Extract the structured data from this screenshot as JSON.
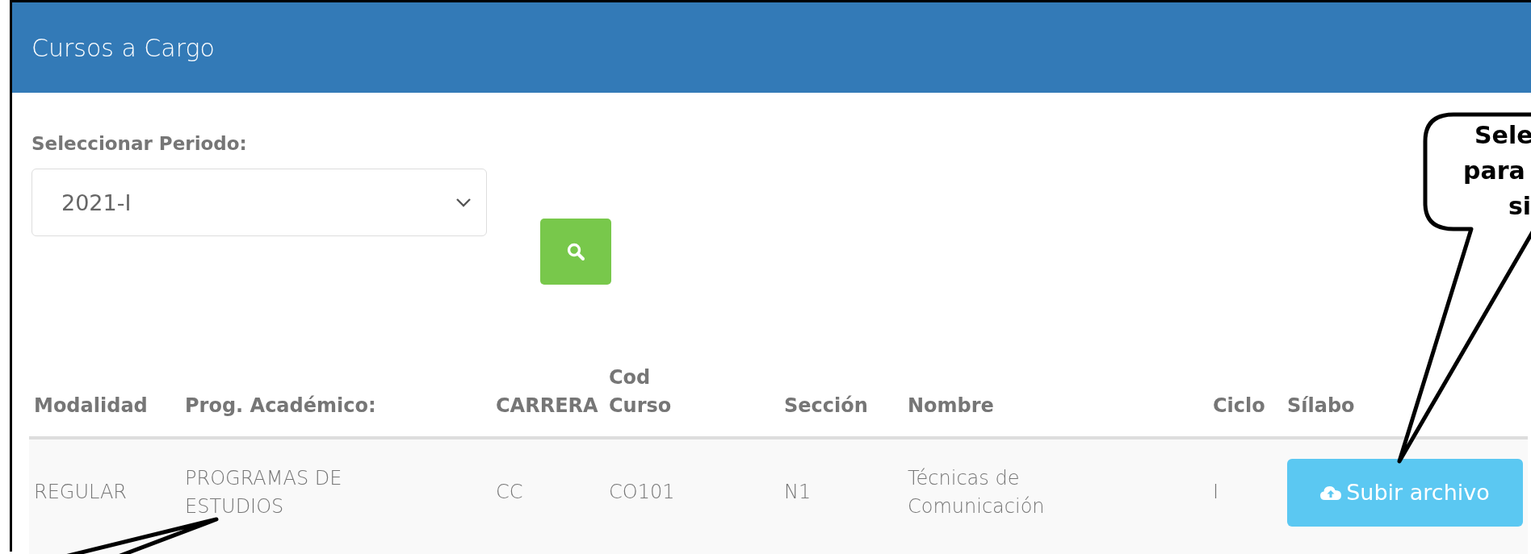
{
  "panel": {
    "title": "Cursos a Cargo"
  },
  "period": {
    "label": "Seleccionar Periodo:",
    "value": "2021-I"
  },
  "table": {
    "columns": [
      {
        "label": "Modalidad"
      },
      {
        "label": "Prog. Académico:"
      },
      {
        "label": "CARRERA"
      },
      {
        "label": "Cod Curso"
      },
      {
        "label": "Sección"
      },
      {
        "label": "Nombre"
      },
      {
        "label": "Ciclo"
      },
      {
        "label": "Sílabo"
      }
    ],
    "rows": [
      {
        "cells": [
          "REGULAR",
          "PROGRAMAS DE ESTUDIOS",
          "CC",
          "CO101",
          "N1",
          "Técnicas de Comunicación",
          "I"
        ],
        "action": "Subir archivo"
      }
    ]
  },
  "callout": {
    "lines": [
      "Sele",
      "para",
      "si"
    ]
  }
}
